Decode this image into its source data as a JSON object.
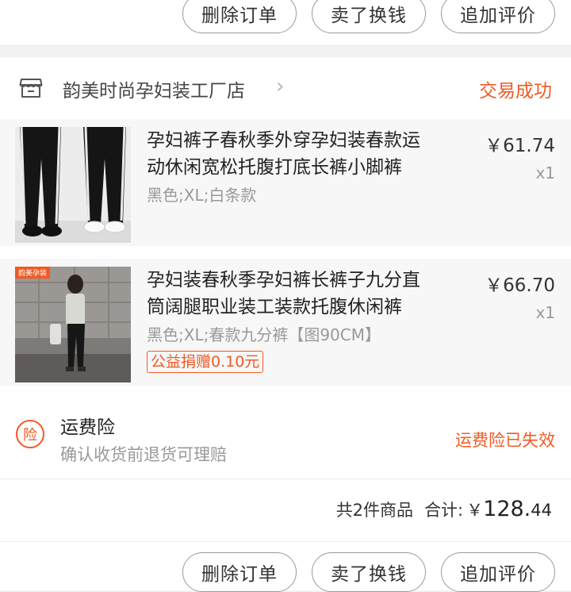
{
  "top_actions": {
    "delete_label": "删除订单",
    "sell_label": "卖了换钱",
    "review_label": "追加评价"
  },
  "shop": {
    "icon": "store-icon",
    "name": "韵美时尚孕妇装工厂店",
    "chevron": "›",
    "status": "交易成功",
    "status_color": "#f15a22"
  },
  "items": [
    {
      "title": "孕妇裤子春秋季外穿孕妇装春款运动休闲宽松托腹打底长裤小脚裤",
      "spec": "黑色;XL;白条款",
      "price": "￥61.74",
      "qty": "x1"
    },
    {
      "title": "孕妇装春秋季孕妇裤长裤子九分直筒阔腿职业装工装款托腹休闲裤",
      "spec": "黑色;XL;春款九分裤【图90CM】",
      "price": "￥66.70",
      "qty": "x1",
      "badge_text": "韵美孕装",
      "charity": "公益捐赠0.10元"
    }
  ],
  "insurance": {
    "badge": "险",
    "title": "运费险",
    "subtitle": "确认收货前退货可理赔",
    "status": "运费险已失效"
  },
  "summary": {
    "count_text": "共2件商品",
    "total_label": "合计:",
    "currency": "￥",
    "total_int": "128.",
    "total_dec": "44"
  },
  "bottom_actions": {
    "delete_label": "删除订单",
    "sell_label": "卖了换钱",
    "review_label": "追加评价"
  }
}
